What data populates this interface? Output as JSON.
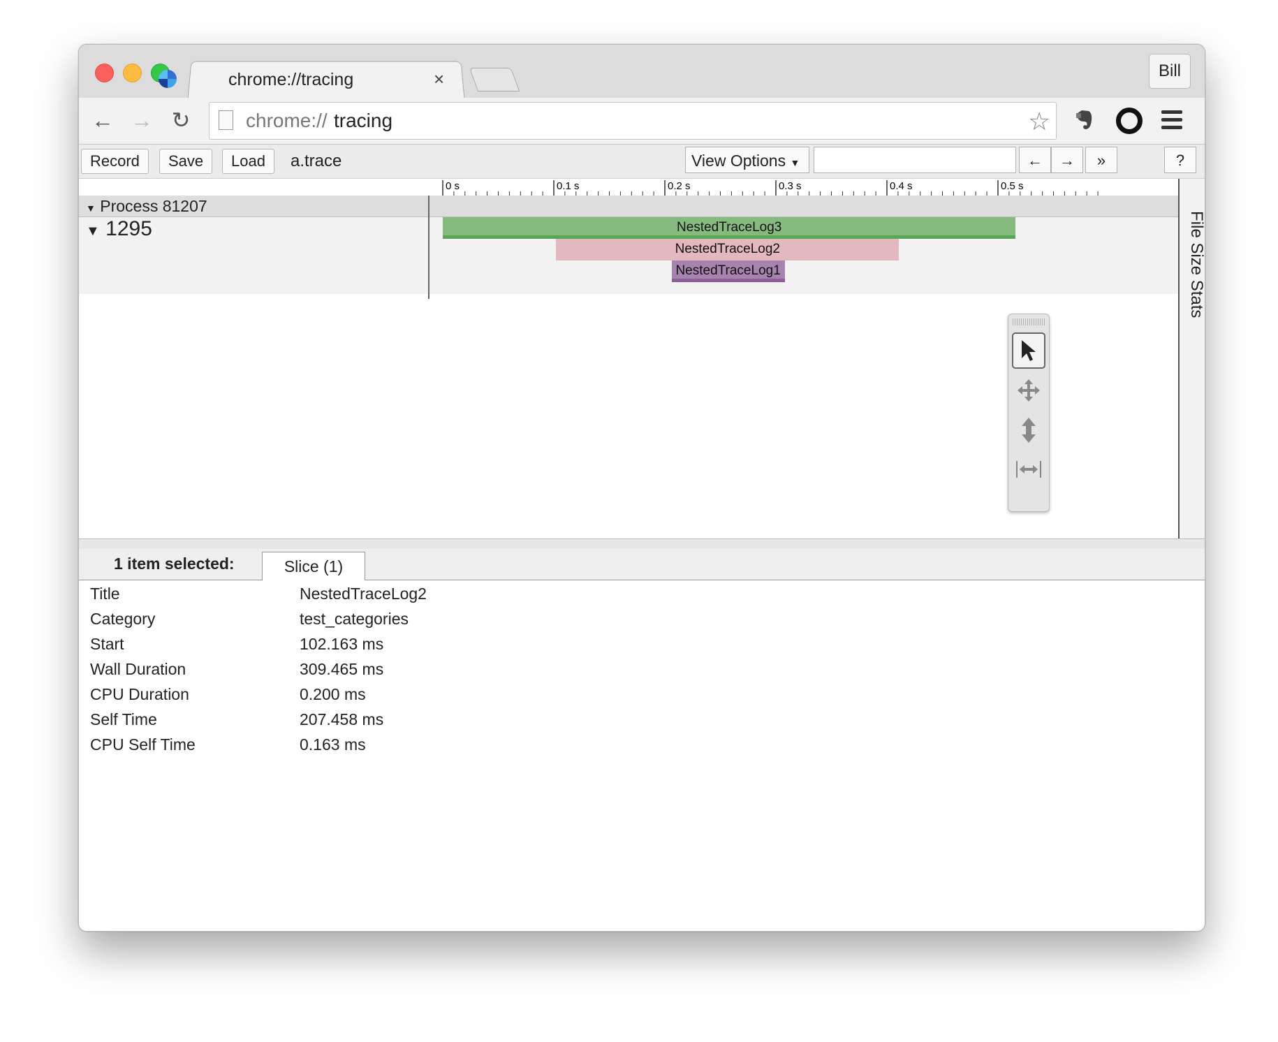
{
  "tab": {
    "title": "chrome://tracing",
    "close": "×"
  },
  "profile": "Bill",
  "url": {
    "scheme": "chrome://",
    "host": "tracing"
  },
  "nav": {
    "back": "←",
    "forward": "→",
    "reload": "↻",
    "star": "☆"
  },
  "tracing_toolbar": {
    "record": "Record",
    "save": "Save",
    "load": "Load",
    "filename": "a.trace",
    "view_options": "View Options",
    "prev": "←",
    "next": "→",
    "more": "»",
    "help": "?"
  },
  "ruler_ticks": [
    "0 s",
    "0.1 s",
    "0.2 s",
    "0.3 s",
    "0.4 s",
    "0.5 s"
  ],
  "process_label": "Process 81207",
  "thread_label": "1295",
  "slices": [
    {
      "name": "NestedTraceLog3",
      "start": 0.0,
      "end": 0.516,
      "depth": 0,
      "color": "#86bb7f",
      "bottom": "#5aa654"
    },
    {
      "name": "NestedTraceLog2",
      "start": 0.102,
      "end": 0.411,
      "depth": 1,
      "color": "#e3b8bf",
      "bottom": "#e3b8bf"
    },
    {
      "name": "NestedTraceLog1",
      "start": 0.206,
      "end": 0.308,
      "depth": 2,
      "color": "#a783b0",
      "bottom": "#8c5f99"
    }
  ],
  "side_panel": "File Size Stats",
  "analysis": {
    "selection_label": "1 item selected:",
    "tab": "Slice (1)",
    "rows": [
      {
        "key": "Title",
        "value": "NestedTraceLog2"
      },
      {
        "key": "Category",
        "value": "test_categories"
      },
      {
        "key": "Start",
        "value": "102.163 ms"
      },
      {
        "key": "Wall Duration",
        "value": "309.465 ms"
      },
      {
        "key": "CPU Duration",
        "value": "0.200 ms"
      },
      {
        "key": "Self Time",
        "value": "207.458 ms"
      },
      {
        "key": "CPU Self Time",
        "value": "0.163 ms"
      }
    ]
  }
}
